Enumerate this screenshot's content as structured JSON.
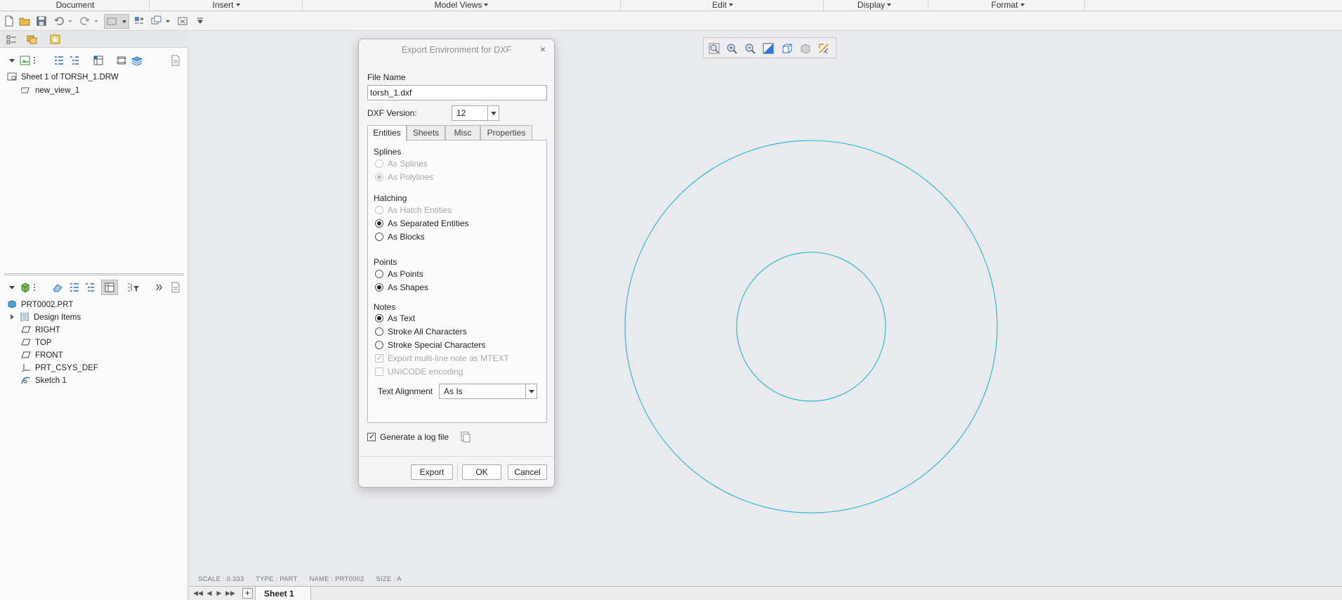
{
  "menubar": {
    "items": [
      {
        "label": "Document",
        "has_caret": false
      },
      {
        "label": "Insert",
        "has_caret": true
      },
      {
        "label": "Model Views",
        "has_caret": true
      },
      {
        "label": "Edit",
        "has_caret": true
      },
      {
        "label": "Display",
        "has_caret": true
      },
      {
        "label": "Format",
        "has_caret": true
      }
    ]
  },
  "left_panel": {
    "drawing_tree": [
      {
        "label": "Sheet 1 of TORSH_1.DRW",
        "icon": "sheet-icon"
      },
      {
        "label": "new_view_1",
        "icon": "view-icon"
      }
    ],
    "model_tree": [
      {
        "label": "PRT0002.PRT",
        "icon": "part-icon"
      },
      {
        "label": "Design Items",
        "icon": "design-items-icon"
      },
      {
        "label": "RIGHT",
        "icon": "datum-plane-icon"
      },
      {
        "label": "TOP",
        "icon": "datum-plane-icon"
      },
      {
        "label": "FRONT",
        "icon": "datum-plane-icon"
      },
      {
        "label": "PRT_CSYS_DEF",
        "icon": "csys-icon"
      },
      {
        "label": "Sketch 1",
        "icon": "sketch-icon"
      }
    ]
  },
  "dialog": {
    "title": "Export Environment for DXF",
    "file_name_label": "File Name",
    "file_name_value": "torsh_1.dxf",
    "dxf_version_label": "DXF Version:",
    "dxf_version_value": "12",
    "tabs": [
      "Entities",
      "Sheets",
      "Misc",
      "Properties"
    ],
    "active_tab": "Entities",
    "splines": {
      "label": "Splines",
      "options": [
        {
          "label": "As Splines",
          "selected": false,
          "enabled": false
        },
        {
          "label": "As Polylines",
          "selected": true,
          "enabled": false
        }
      ]
    },
    "hatching": {
      "label": "Hatching",
      "options": [
        {
          "label": "As Hatch Entities",
          "selected": false,
          "enabled": false
        },
        {
          "label": "As Separated Entities",
          "selected": true,
          "enabled": true
        },
        {
          "label": "As Blocks",
          "selected": false,
          "enabled": true
        }
      ]
    },
    "points": {
      "label": "Points",
      "options": [
        {
          "label": "As Points",
          "selected": false,
          "enabled": true
        },
        {
          "label": "As Shapes",
          "selected": true,
          "enabled": true
        }
      ]
    },
    "notes": {
      "label": "Notes",
      "options": [
        {
          "label": "As Text",
          "selected": true,
          "enabled": true
        },
        {
          "label": "Stroke All Characters",
          "selected": false,
          "enabled": true
        },
        {
          "label": "Stroke Special Characters",
          "selected": false,
          "enabled": true
        }
      ],
      "checkboxes": [
        {
          "label": "Export multi-line note as MTEXT",
          "checked": true,
          "enabled": false
        },
        {
          "label": "UNICODE encoding",
          "checked": false,
          "enabled": false
        }
      ]
    },
    "text_alignment_label": "Text Alignment",
    "text_alignment_value": "As Is",
    "log_file_label": "Generate a log file",
    "log_file_checked": true,
    "buttons": {
      "export": "Export",
      "ok": "OK",
      "cancel": "Cancel"
    }
  },
  "status": {
    "scale": "SCALE : 0.333",
    "type": "TYPE : PART",
    "name": "NAME : PRT0002",
    "size": "SIZE : A"
  },
  "sheets": {
    "active": "Sheet 1"
  },
  "colors": {
    "geometry": "#1fb6cf",
    "canvas": "#e9eaed"
  }
}
